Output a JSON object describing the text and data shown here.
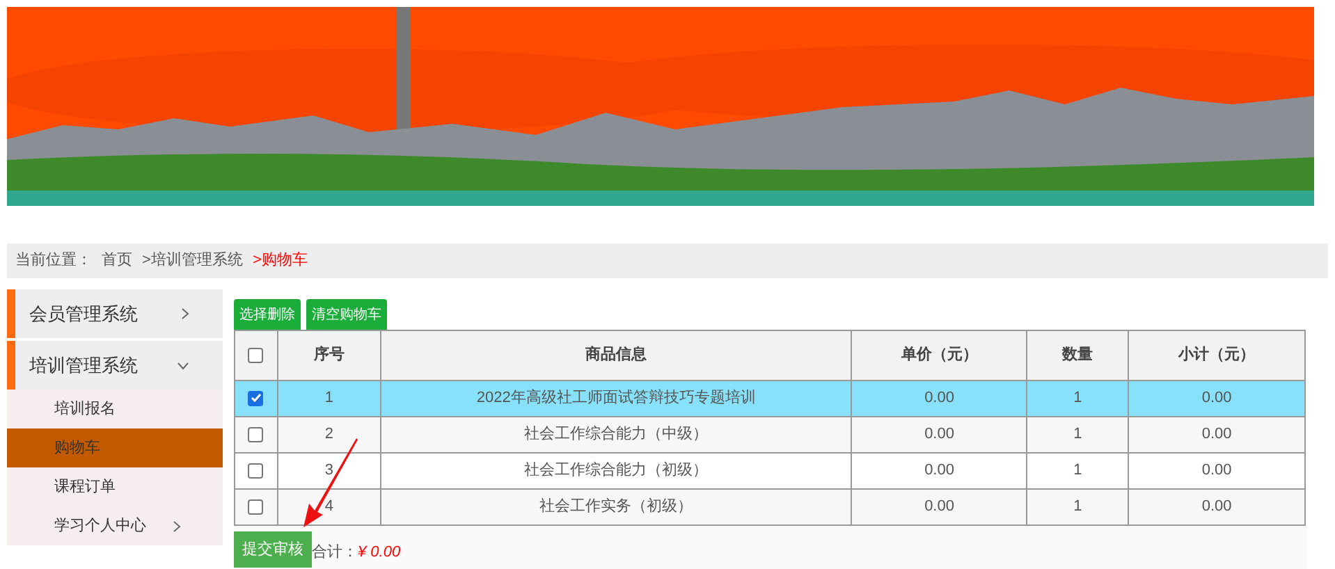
{
  "breadcrumb": {
    "label": "当前位置：",
    "items": [
      {
        "text": "首页",
        "current": false
      },
      {
        "text": ">培训管理系统",
        "current": false
      },
      {
        "text": ">购物车",
        "current": true
      }
    ]
  },
  "sidebar": {
    "items": [
      {
        "label": "会员管理系统",
        "expanded": false
      },
      {
        "label": "培训管理系统",
        "expanded": true,
        "children": [
          {
            "label": "培训报名",
            "selected": false,
            "has_submenu": false
          },
          {
            "label": "购物车",
            "selected": true,
            "has_submenu": false
          },
          {
            "label": "课程订单",
            "selected": false,
            "has_submenu": false
          },
          {
            "label": "学习个人中心",
            "selected": false,
            "has_submenu": true
          }
        ]
      }
    ]
  },
  "toolbar": [
    "选择删除",
    "清空购物车"
  ],
  "table": {
    "select_all": false,
    "columns": [
      "序号",
      "商品信息",
      "单价（元）",
      "数量",
      "小计（元）"
    ],
    "rows": [
      {
        "checked": true,
        "cells": [
          "1",
          "2022年高级社工师面试答辩技巧专题培训",
          "0.00",
          "1",
          "0.00"
        ]
      },
      {
        "checked": false,
        "cells": [
          "2",
          "社会工作综合能力（中级）",
          "0.00",
          "1",
          "0.00"
        ]
      },
      {
        "checked": false,
        "cells": [
          "3",
          "社会工作综合能力（初级）",
          "0.00",
          "1",
          "0.00"
        ]
      },
      {
        "checked": false,
        "cells": [
          "4",
          "社会工作实务（初级）",
          "0.00",
          "1",
          "0.00"
        ]
      }
    ]
  },
  "footer": {
    "submit": "提交审核",
    "total_label": "合计：",
    "total": "¥ 0.00"
  }
}
